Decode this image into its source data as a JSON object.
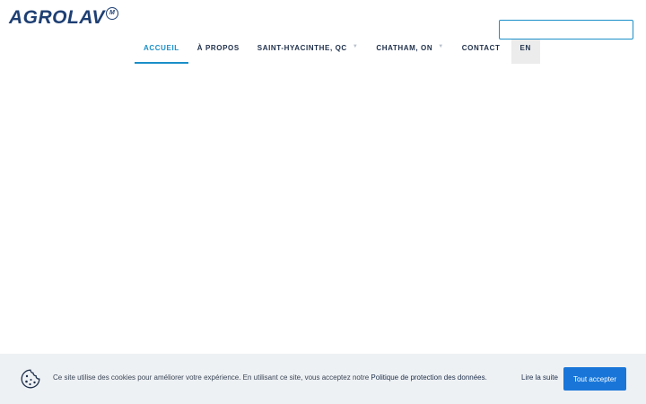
{
  "header": {
    "logo_text": "AGROLAV",
    "logo_mark": "M",
    "nav": [
      {
        "label": "ACCUEIL",
        "active": true,
        "has_dropdown": false
      },
      {
        "label": "À PROPOS",
        "active": false,
        "has_dropdown": false
      },
      {
        "label": "SAINT-HYACINTHE, QC",
        "active": false,
        "has_dropdown": true
      },
      {
        "label": "CHATHAM, ON",
        "active": false,
        "has_dropdown": true
      },
      {
        "label": "CONTACT",
        "active": false,
        "has_dropdown": false
      },
      {
        "label": "EN",
        "active": false,
        "has_dropdown": false
      }
    ],
    "search": {
      "value": "",
      "placeholder": ""
    }
  },
  "cookie_bar": {
    "icon": "cookie-icon",
    "text_prefix": "Ce site utilise des cookies pour améliorer votre expérience. En utilisant ce site, vous acceptez notre ",
    "policy_link": "Politique de protection des données",
    "text_suffix": ".",
    "read_more": "Lire la suite",
    "accept_label": "Tout accepter"
  },
  "colors": {
    "brand": "#1e3f73",
    "accent": "#1a8fc9",
    "button": "#1976d8",
    "cookie_bg": "#eef1f4"
  }
}
